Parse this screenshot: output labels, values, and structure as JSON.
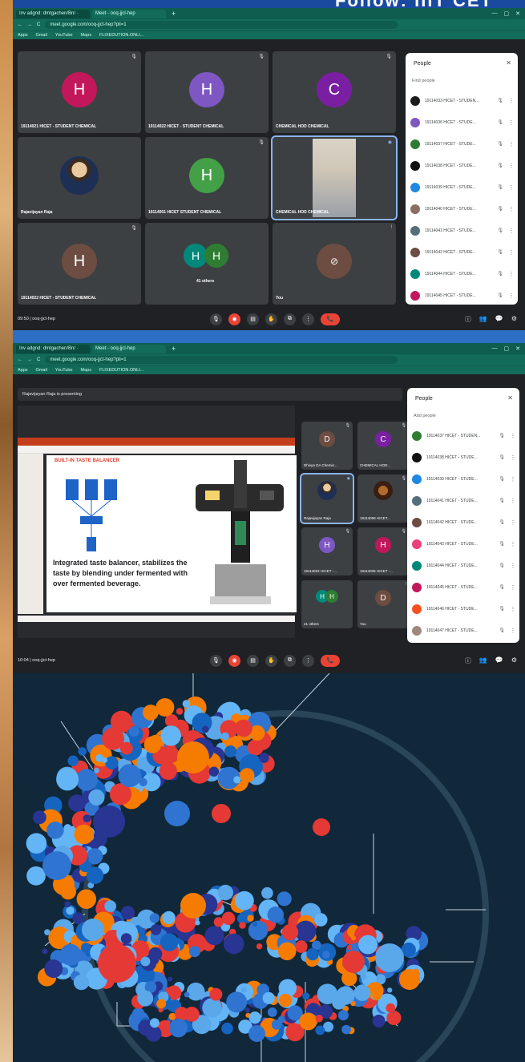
{
  "banner": {
    "text": "Follow: IIIT CET"
  },
  "browser": {
    "tabs": [
      "Inv adgnd: dmtgachen/Bn/ ·",
      "Meet - ooq-jjcl-hep"
    ],
    "url": "meet.google.com/ooq-jjct-hep?pli=1",
    "bookmarks": [
      "Apps",
      "Gmail",
      "YouTube",
      "Maps",
      "FLIXEDUTION.ONLI..."
    ]
  },
  "screen1": {
    "tiles": [
      {
        "name": "19114021 HICET - STUDENT CHEMICAL",
        "initial": "H",
        "color": "#c2185b"
      },
      {
        "name": "19114022 HICET - STUDENT CHEMICAL",
        "initial": "H",
        "color": "#7e57c2"
      },
      {
        "name": "CHEMICAL HOD CHEMICAL",
        "initial": "C",
        "color": "#7b1fa2"
      },
      {
        "name": "Rajavijayan Raja",
        "initial": "",
        "color": ""
      },
      {
        "name": "19114001 HICET STUDENT CHEMICAL",
        "initial": "H",
        "color": "#43a047"
      },
      {
        "name": "CHEMICAL HOD CHEMICAL",
        "initial": "",
        "color": ""
      },
      {
        "name": "19114022 HICET - STUDENT CHEMICAL",
        "initial": "H",
        "color": "#6d4c41"
      },
      {
        "name": "41 others",
        "initial": "H",
        "color": "#00897b"
      },
      {
        "name": "You",
        "initial": "",
        "color": ""
      }
    ],
    "others_second_initial": "H",
    "people": {
      "title": "People",
      "add": "Find people",
      "list": [
        {
          "name": "19114033 HICET - STUDEN...",
          "color": "#1b1b1b"
        },
        {
          "name": "19114036 HICET - STUDE...",
          "color": "#7e57c2"
        },
        {
          "name": "19114037 HICET - STUDE...",
          "color": "#2e7d32"
        },
        {
          "name": "19114038 HICET - STUDE...",
          "color": "#111111"
        },
        {
          "name": "19114039 HICET - STUDE...",
          "color": "#1e88e5"
        },
        {
          "name": "19114040 HICET - STUDE...",
          "color": "#8d6e63"
        },
        {
          "name": "19114041 HICET - STUDE...",
          "color": "#546e7a"
        },
        {
          "name": "19114042 HICET - STUDE...",
          "color": "#6d4c41"
        },
        {
          "name": "19114044 HICET - STUDE...",
          "color": "#00897b"
        },
        {
          "name": "19114045 HICET - STUDE...",
          "color": "#c2185b"
        }
      ]
    },
    "clock": "09:50 | ooq-jjct-hep"
  },
  "screen2": {
    "presenting": "Rajavijayan Raja is presenting",
    "slide": {
      "title": "BUILT-IN TASTE BALANCER",
      "body": "Integrated taste balancer, stabilizes the taste by blending under fermented with over fermented beverage."
    },
    "tiles": [
      {
        "name": "Dhivya GA Chemis...",
        "initial": "D",
        "color": "#6d4c41"
      },
      {
        "name": "CHEMICAL HOD...",
        "initial": "C",
        "color": "#7b1fa2"
      },
      {
        "name": "Rajavijayan Raja",
        "initial": "",
        "color": ""
      },
      {
        "name": "19114059 HICET...",
        "initial": "",
        "color": ""
      },
      {
        "name": "19114022 HICET -...",
        "initial": "H",
        "color": "#7e57c2"
      },
      {
        "name": "19114035 HICET -...",
        "initial": "H",
        "color": "#c2185b"
      },
      {
        "name": "41 others",
        "initial": "H",
        "color": "#00897b"
      },
      {
        "name": "You",
        "initial": "D",
        "color": "#6d4c41"
      }
    ],
    "people": {
      "title": "People",
      "add": "Add people",
      "list": [
        {
          "name": "19114037 HICET - STUDEN...",
          "color": "#2e7d32"
        },
        {
          "name": "19114038 HICET - STUDE...",
          "color": "#111111"
        },
        {
          "name": "19114039 HICET - STUDE...",
          "color": "#1e88e5"
        },
        {
          "name": "19114041 HICET - STUDE...",
          "color": "#546e7a"
        },
        {
          "name": "19114042 HICET - STUDE...",
          "color": "#6d4c41"
        },
        {
          "name": "19114043 HICET - STUDE...",
          "color": "#ec407a"
        },
        {
          "name": "19114044 HICET - STUDE...",
          "color": "#00897b"
        },
        {
          "name": "19114045 HICET - STUDE...",
          "color": "#c2185b"
        },
        {
          "name": "19114046 HICET - STUDE...",
          "color": "#f4511e"
        },
        {
          "name": "19114047 HICET - STUDE...",
          "color": "#a1887f"
        }
      ]
    },
    "clock": "10:04 | ooq-jjct-hep"
  },
  "icons": {
    "mic": "🎙",
    "more": "⋮",
    "close": "✕",
    "add_person": "👤+",
    "info": "ⓘ",
    "people": "👥",
    "chat": "💬",
    "activities": "⚙",
    "end": "📞",
    "cam": "◉",
    "cc": "▤",
    "hand": "✋",
    "present": "⧉"
  },
  "colors": {
    "meet_bg": "#202124",
    "tile_bg": "#3c4043",
    "end_red": "#ea4335",
    "chrome_green": "#136b5a",
    "art_bg": "#10283a",
    "art_palette": [
      "#1565c0",
      "#2f74d0",
      "#5aa7ea",
      "#283593",
      "#f57c00",
      "#e53935",
      "#64b5f6"
    ]
  }
}
